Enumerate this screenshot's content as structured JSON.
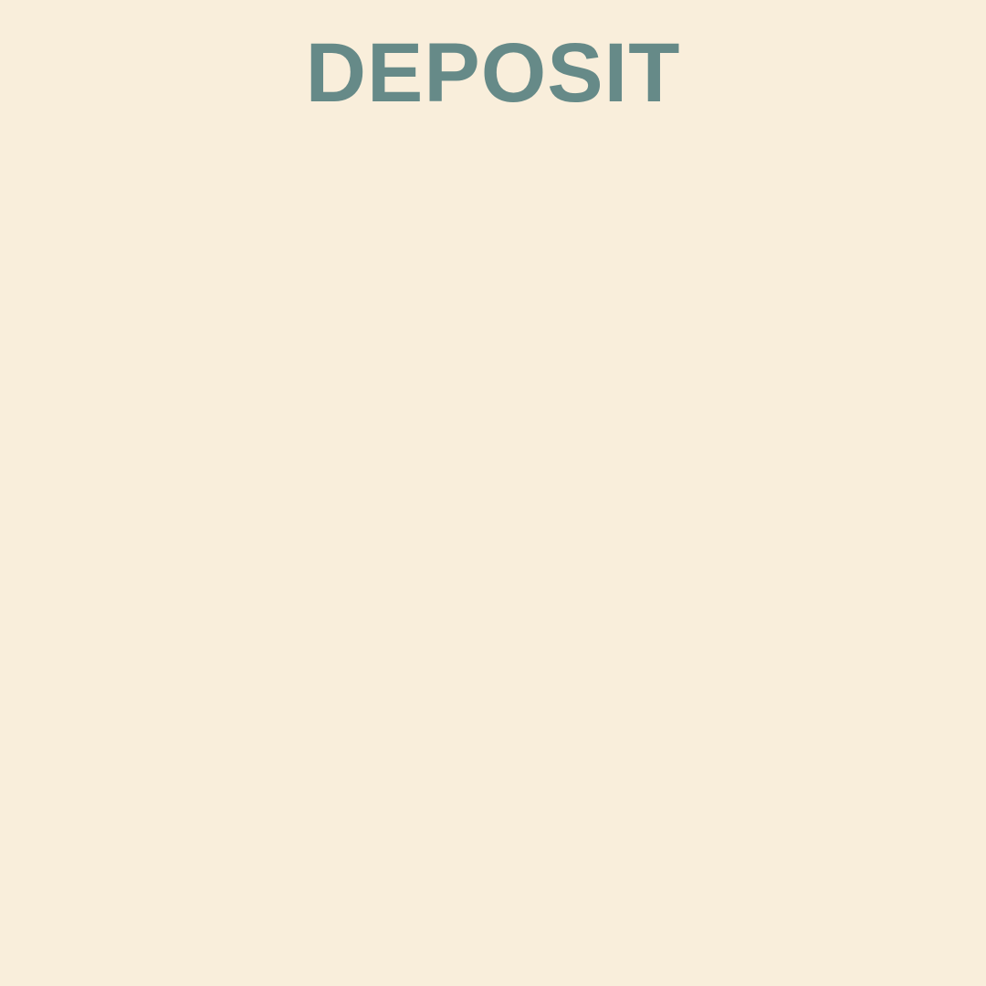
{
  "page": {
    "title": "DEPOSIT"
  },
  "colors": {
    "background": "#f9eedb",
    "title": "#668a88"
  }
}
